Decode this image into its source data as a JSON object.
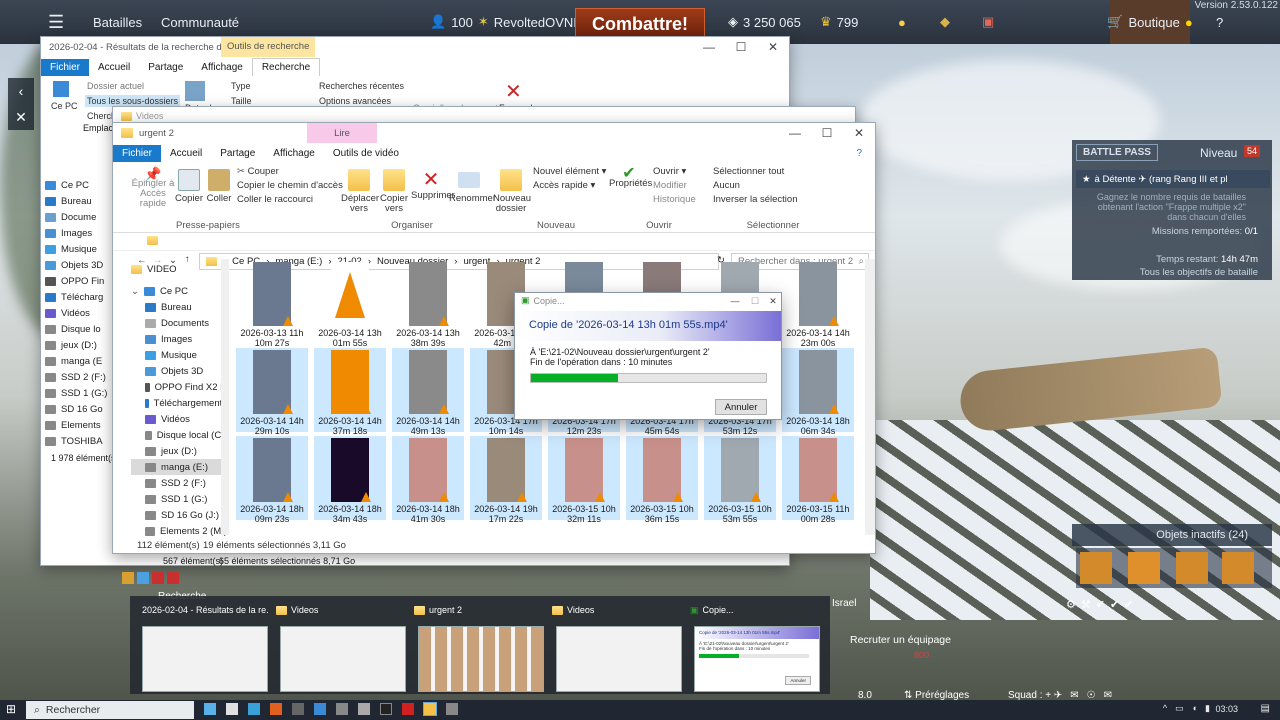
{
  "game": {
    "menu_battles": "Batailles",
    "menu_community": "Communauté",
    "squad_count": "100",
    "player_name": "RevoltedOVNI",
    "combat_label": "Combattre!",
    "silver_lions": "3 250 065",
    "golden_eagles": "799",
    "shop_label": "Boutique",
    "version": "Version 2.53.0.122",
    "inactive_objects": "Objets inactifs (24)",
    "recruit_crew": "Recruter un équipage",
    "crew_cost": "800",
    "rating": "8.0",
    "presets": "Préréglages",
    "squad_label": "Squad :",
    "israel": "Israel",
    "research": "Recherche"
  },
  "battlepass": {
    "label": "BATTLE PASS",
    "level_label": "Niveau",
    "level": "54",
    "challenge": "à Détente ✈ (rang Rang III et pl",
    "desc": "Gagnez le nombre requis de batailles obtenant l'action \"Frappe multiple x2\" dans chacun d'elles",
    "missions_label": "Missions remportées:",
    "missions_value": "0/1",
    "time_label": "Temps restant:",
    "time_value": "14h 47m",
    "all_objectives": "Tous les objectifs de bataille"
  },
  "win_back": {
    "title": "2026-02-04 - Résultats de la recherche dans ...",
    "context_tab": "Outils de recherche",
    "tabs": [
      "Fichier",
      "Accueil",
      "Partage",
      "Affichage",
      "Recherche"
    ],
    "current_folder": "Dossier actuel",
    "all_subfolders": "Tous les sous-dossiers",
    "search_again": "Cherch",
    "type": "Type",
    "size": "Taille",
    "recent_searches": "Recherches récentes",
    "advanced_options": "Options avancées",
    "open_location": "Ouvrir l'emplacement",
    "close_search": "Fermer la",
    "date": "Date de",
    "pc": "Ce PC",
    "location": "Emplaceme",
    "count": "1 978 élément(s)",
    "count2": "567 élément(s)",
    "selected2": "65 éléments sélectionnés  8,71 Go"
  },
  "win_videos": {
    "title": "Videos"
  },
  "explorer": {
    "title": "urgent 2",
    "context_tab": "Lire",
    "tabs": [
      "Fichier",
      "Accueil",
      "Partage",
      "Affichage",
      "Outils de vidéo"
    ],
    "ribbon": {
      "pin": "Épingler à Accès rapide",
      "copy": "Copier",
      "paste": "Coller",
      "cut": "Couper",
      "copy_path": "Copier le chemin d'accès",
      "paste_shortcut": "Coller le raccourci",
      "clipboard_group": "Presse-papiers",
      "move_to": "Déplacer vers",
      "copy_to": "Copier vers",
      "delete": "Supprimer",
      "rename": "Renommer",
      "organize_group": "Organiser",
      "new_folder": "Nouveau dossier",
      "new_item": "Nouvel élément",
      "easy_access": "Accès rapide",
      "new_group": "Nouveau",
      "properties": "Propriétés",
      "open": "Ouvrir",
      "modify": "Modifier",
      "history": "Historique",
      "open_group": "Ouvrir",
      "select_all": "Sélectionner tout",
      "select_none": "Aucun",
      "invert_selection": "Inverser la sélection",
      "select_group": "Sélectionner"
    },
    "breadcrumb": [
      "Ce PC",
      "manga (E:)",
      "21-02",
      "Nouveau dossier",
      "urgent",
      "urgent 2"
    ],
    "search_placeholder": "Rechercher dans : urgent 2",
    "sidebar": [
      "VIDEO",
      "Ce PC",
      "Bureau",
      "Documents",
      "Images",
      "Musique",
      "Objets 3D",
      "OPPO Find X2 N",
      "Téléchargements",
      "Vidéos",
      "Disque local (C:)",
      "jeux  (D:)",
      "manga (E:)",
      "SSD 2 (F:)",
      "SSD 1 (G:)",
      "SD 16 Go (J:)",
      "Elements 2 (M:)"
    ],
    "back_sidebar": [
      "Ce PC",
      "Bureau",
      "Docume",
      "Images",
      "Musique",
      "Objets 3D",
      "OPPO Fin",
      "Télécharg",
      "Vidéos",
      "Disque lo",
      "jeux  (D:)",
      "manga (E",
      "SSD 2 (F:)",
      "SSD 1 (G:)",
      "SD 16 Go",
      "Elements",
      "TOSHIBA"
    ],
    "files": [
      [
        "2026-03-13 11h",
        "10m 27s"
      ],
      [
        "2026-03-14 13h",
        "01m 55s"
      ],
      [
        "2026-03-14 13h",
        "38m 39s"
      ],
      [
        "2026-03-14 13h",
        "42m 5"
      ],
      [
        "",
        ""
      ],
      [
        "",
        ""
      ],
      [
        "",
        ""
      ],
      [
        "2026-03-14 14h",
        "23m 00s"
      ],
      [
        "2026-03-14 14h",
        "29m 10s"
      ],
      [
        "2026-03-14 14h",
        "37m 18s"
      ],
      [
        "2026-03-14 14h",
        "49m 13s"
      ],
      [
        "2026-03-14 17h",
        "10m 14s"
      ],
      [
        "2026-03-14 17h",
        "12m 23s"
      ],
      [
        "2026-03-14 17h",
        "45m 54s"
      ],
      [
        "2026-03-14 17h",
        "53m 12s"
      ],
      [
        "2026-03-14 18h",
        "06m 34s"
      ],
      [
        "2026-03-14 18h",
        "09m 23s"
      ],
      [
        "2026-03-14 18h",
        "34m 43s"
      ],
      [
        "2026-03-14 18h",
        "41m 30s"
      ],
      [
        "2026-03-14 19h",
        "17m 22s"
      ],
      [
        "2026-03-15 10h",
        "32m 11s"
      ],
      [
        "2026-03-15 10h",
        "36m 15s"
      ],
      [
        "2026-03-15 10h",
        "53m 55s"
      ],
      [
        "2026-03-15 11h",
        "00m 28s"
      ]
    ],
    "status_count": "112 élément(s)",
    "status_selected": "19 éléments sélectionnés  3,11 Go"
  },
  "dialog": {
    "title": "Copie...",
    "heading": "Copie de '2026-03-14 13h 01m 55s.mp4'",
    "dest": "À 'E:\\21-02\\Nouveau dossier\\urgent\\urgent 2'",
    "eta": "Fin de l'opération dans : 10 minutes",
    "progress": 0.37,
    "cancel": "Annuler"
  },
  "taskswitch": [
    {
      "label": "2026-02-04 - Résultats de la re..."
    },
    {
      "label": "Videos"
    },
    {
      "label": "urgent 2"
    },
    {
      "label": "Videos"
    },
    {
      "label": "Copie..."
    }
  ],
  "preview": {
    "heading": "Copie de '2026-03-14 13h 01m 55s.mp4'",
    "dest": "À 'E:\\21-02\\Nouveau dossier\\urgent\\urgent 2'",
    "eta": "Fin de l'opération dans : 10 minutes",
    "cancel": "Annuler"
  },
  "taskbar": {
    "search": "Rechercher",
    "time": "03:03"
  },
  "colors": {
    "accent": "#1979ca",
    "progress": "#06b025"
  }
}
